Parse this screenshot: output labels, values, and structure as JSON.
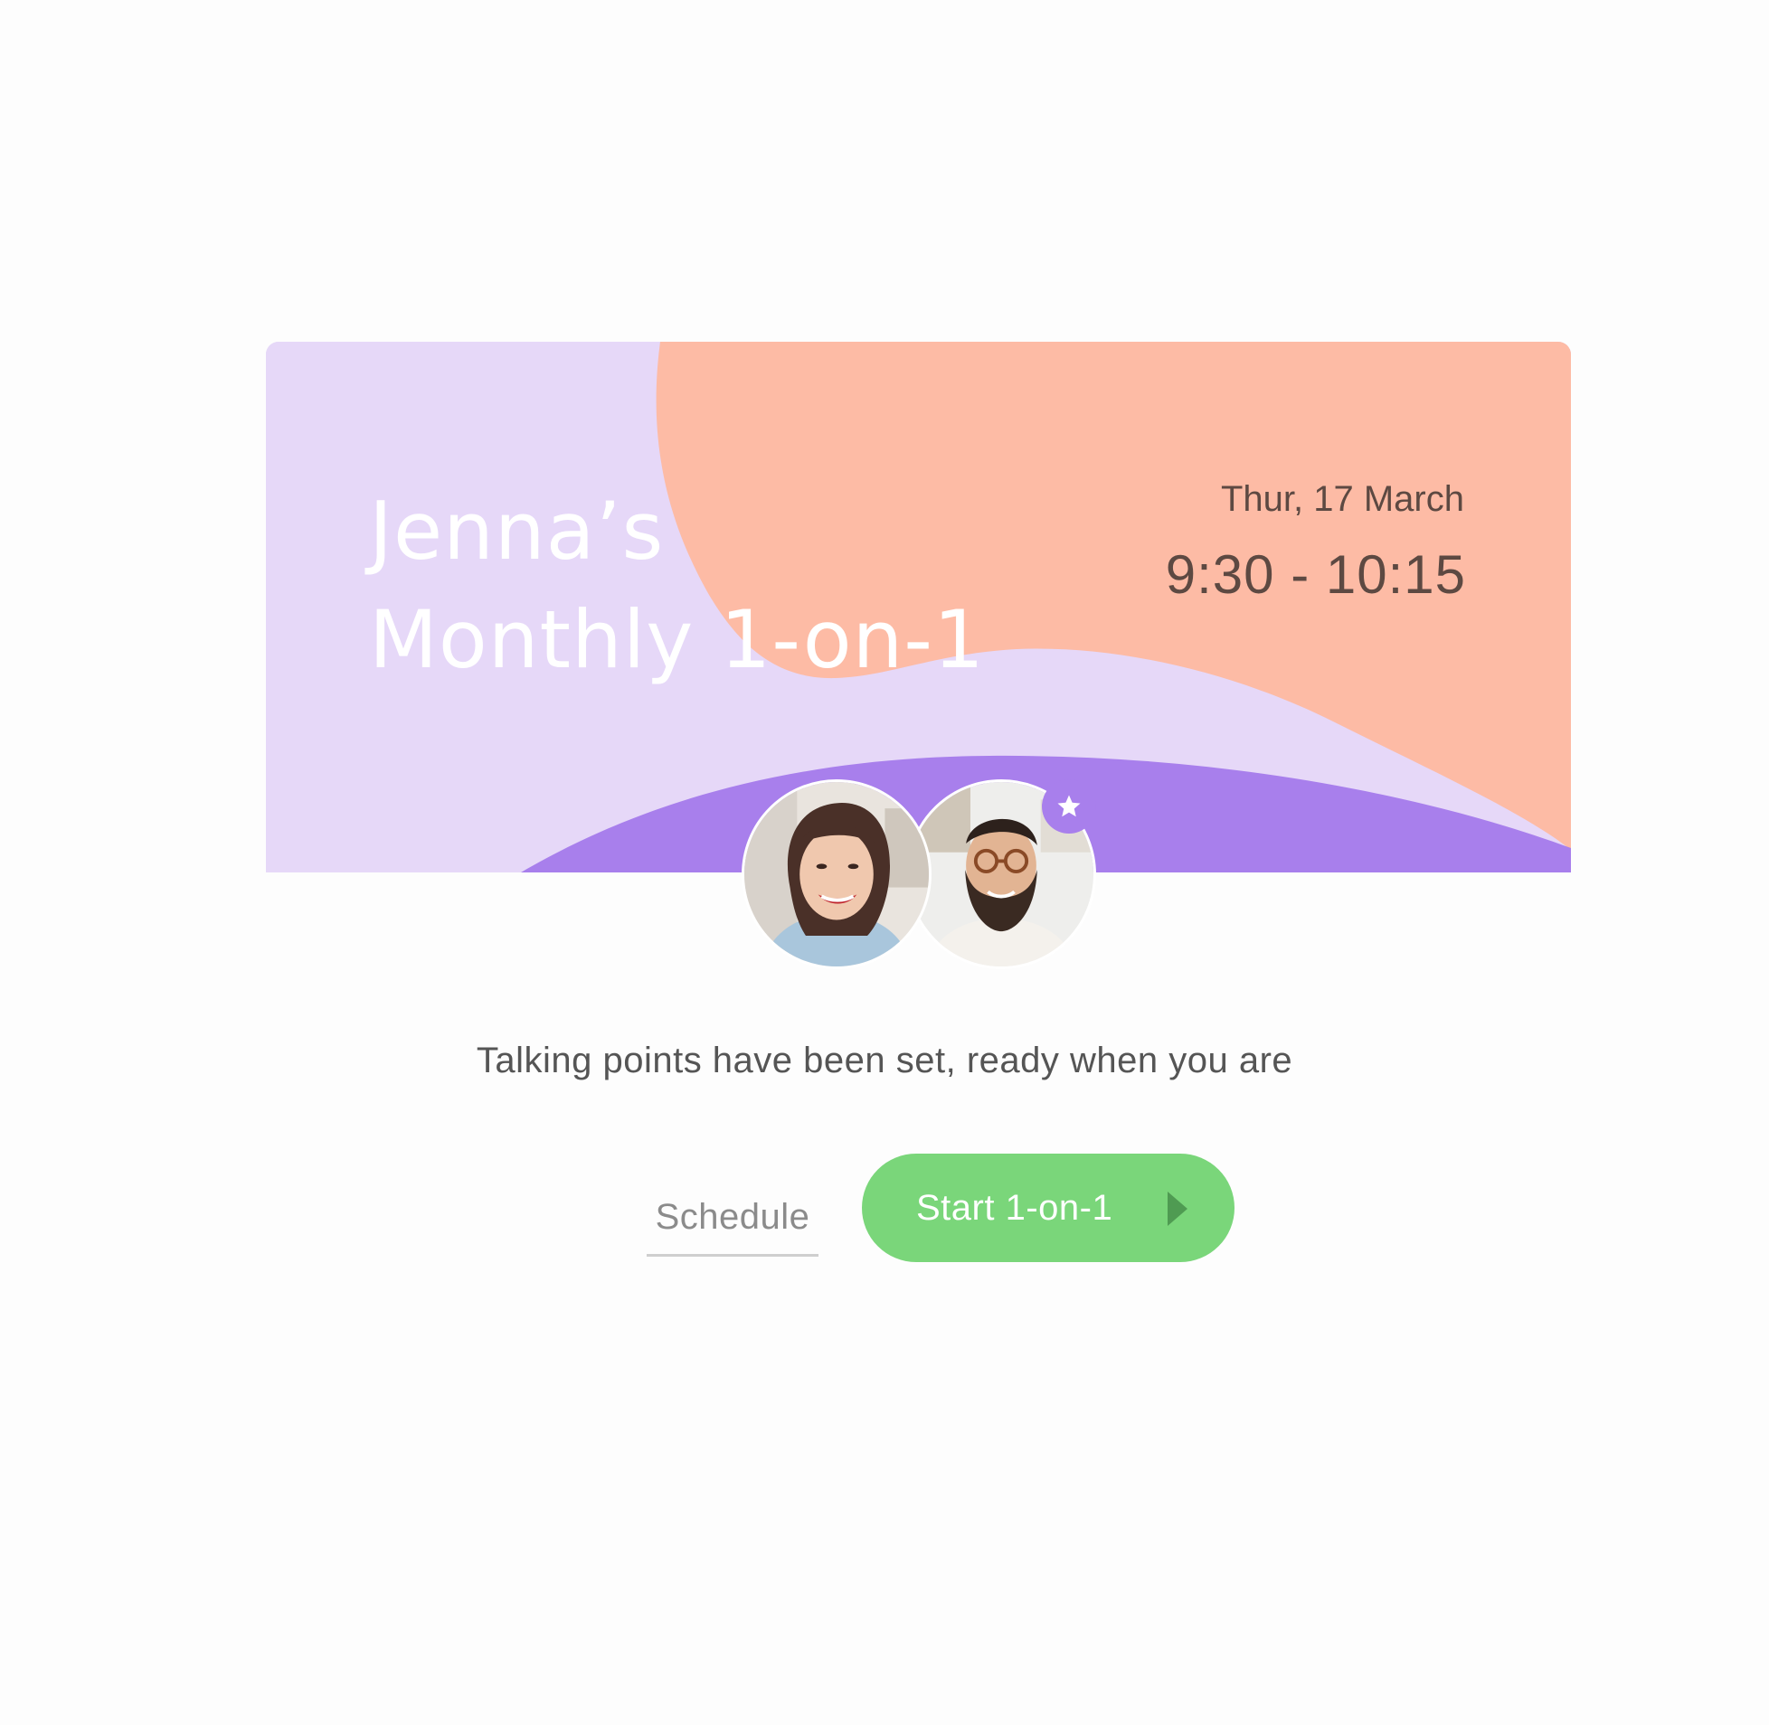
{
  "meeting": {
    "title_line1": "Jenna’s",
    "title_line2": "Monthly 1-on-1",
    "date": "Thur, 17 March",
    "time": "9:30 - 10:15"
  },
  "participants": [
    {
      "role": "attendee",
      "icon": "avatar-photo-woman"
    },
    {
      "role": "host",
      "icon": "avatar-photo-man",
      "badge_icon": "star-icon"
    }
  ],
  "status_message": "Talking points have been set, ready when you are",
  "actions": {
    "schedule_label": "Schedule",
    "start_label": "Start 1-on-1",
    "start_icon": "play-icon"
  },
  "colors": {
    "banner_lavender": "#e6d8f8",
    "banner_peach": "#fdbba5",
    "banner_purple": "#a87fec",
    "start_button": "#7ad67a",
    "play_arrow": "#4f9b52",
    "date_text": "#5d4942"
  }
}
